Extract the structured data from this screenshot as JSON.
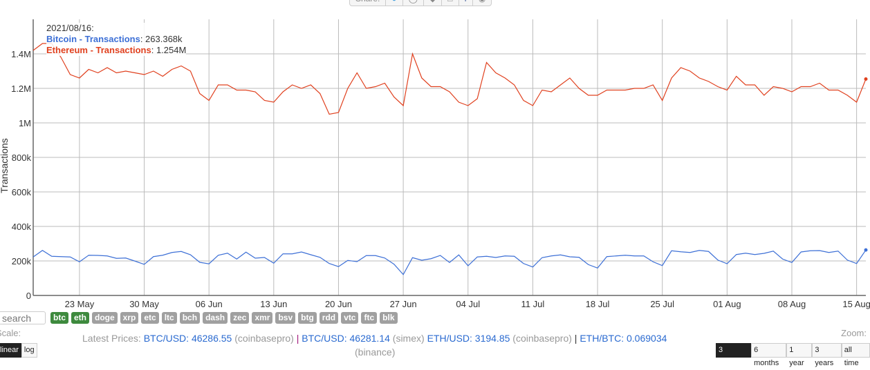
{
  "share": {
    "label": "Share:",
    "icons": [
      "twitter-icon",
      "reddit-icon",
      "vk-icon",
      "like-icon",
      "facebook-icon",
      "pinterest-icon"
    ]
  },
  "tooltip": {
    "date": "2021/08/16:",
    "btc_label": "Bitcoin - Transactions",
    "btc_value": ": 263.368k",
    "eth_label": "Ethereum - Transactions",
    "eth_value": ": 1.254M"
  },
  "chart_data": {
    "type": "line",
    "ylabel": "Transactions",
    "ylim": [
      0,
      1600000
    ],
    "yticks": [
      {
        "v": 0,
        "label": "0"
      },
      {
        "v": 200000,
        "label": "200k"
      },
      {
        "v": 400000,
        "label": "400k"
      },
      {
        "v": 600000,
        "label": "600k"
      },
      {
        "v": 800000,
        "label": "800k"
      },
      {
        "v": 1000000,
        "label": "1M"
      },
      {
        "v": 1200000,
        "label": "1.2M"
      },
      {
        "v": 1400000,
        "label": "1.4M"
      }
    ],
    "xrange": [
      "2021-05-18",
      "2021-08-16"
    ],
    "xticks": [
      {
        "d": "2021-05-23",
        "label": "23 May"
      },
      {
        "d": "2021-05-30",
        "label": "30 May"
      },
      {
        "d": "2021-06-06",
        "label": "06 Jun"
      },
      {
        "d": "2021-06-13",
        "label": "13 Jun"
      },
      {
        "d": "2021-06-20",
        "label": "20 Jun"
      },
      {
        "d": "2021-06-27",
        "label": "27 Jun"
      },
      {
        "d": "2021-07-04",
        "label": "04 Jul"
      },
      {
        "d": "2021-07-11",
        "label": "11 Jul"
      },
      {
        "d": "2021-07-18",
        "label": "18 Jul"
      },
      {
        "d": "2021-07-25",
        "label": "25 Jul"
      },
      {
        "d": "2021-08-01",
        "label": "01 Aug"
      },
      {
        "d": "2021-08-08",
        "label": "08 Aug"
      },
      {
        "d": "2021-08-15",
        "label": "15 Aug"
      }
    ],
    "grid": true,
    "series": [
      {
        "name": "Bitcoin - Transactions",
        "color": "#3c6fd6",
        "values": [
          223000,
          261000,
          227000,
          225000,
          223000,
          195000,
          233000,
          232000,
          229000,
          215000,
          217000,
          199000,
          180000,
          225000,
          233000,
          249000,
          255000,
          236000,
          192000,
          183000,
          233000,
          245000,
          211000,
          251000,
          216000,
          220000,
          187000,
          241000,
          241000,
          252000,
          236000,
          221000,
          185000,
          167000,
          203000,
          196000,
          231000,
          231000,
          217000,
          181000,
          121000,
          219000,
          204000,
          213000,
          232000,
          191000,
          235000,
          172000,
          223000,
          227000,
          220000,
          229000,
          227000,
          185000,
          165000,
          219000,
          229000,
          235000,
          224000,
          221000,
          179000,
          159000,
          225000,
          229000,
          233000,
          229000,
          229000,
          195000,
          173000,
          259000,
          253000,
          249000,
          261000,
          255000,
          205000,
          184000,
          237000,
          245000,
          237000,
          244000,
          257000,
          211000,
          191000,
          252000,
          259000,
          260000,
          249000,
          257000,
          205000,
          185000,
          263368
        ]
      },
      {
        "name": "Ethereum - Transactions",
        "color": "#e0401e",
        "values": [
          1420000,
          1460000,
          1460000,
          1380000,
          1280000,
          1260000,
          1310000,
          1290000,
          1320000,
          1290000,
          1300000,
          1290000,
          1280000,
          1300000,
          1270000,
          1310000,
          1330000,
          1300000,
          1170000,
          1130000,
          1220000,
          1220000,
          1190000,
          1190000,
          1180000,
          1130000,
          1120000,
          1180000,
          1220000,
          1200000,
          1220000,
          1170000,
          1050000,
          1060000,
          1200000,
          1290000,
          1200000,
          1210000,
          1230000,
          1150000,
          1100000,
          1400000,
          1260000,
          1210000,
          1210000,
          1180000,
          1120000,
          1100000,
          1140000,
          1350000,
          1290000,
          1260000,
          1220000,
          1130000,
          1100000,
          1190000,
          1180000,
          1220000,
          1260000,
          1200000,
          1160000,
          1160000,
          1190000,
          1190000,
          1190000,
          1200000,
          1200000,
          1220000,
          1130000,
          1260000,
          1320000,
          1300000,
          1260000,
          1240000,
          1210000,
          1190000,
          1270000,
          1220000,
          1220000,
          1160000,
          1210000,
          1200000,
          1180000,
          1210000,
          1210000,
          1230000,
          1190000,
          1190000,
          1160000,
          1120000,
          1254000
        ]
      }
    ]
  },
  "search": {
    "placeholder": "search"
  },
  "coins": [
    {
      "label": "btc",
      "active": true
    },
    {
      "label": "eth",
      "active": true
    },
    {
      "label": "doge",
      "active": false
    },
    {
      "label": "xrp",
      "active": false
    },
    {
      "label": "etc",
      "active": false
    },
    {
      "label": "ltc",
      "active": false
    },
    {
      "label": "bch",
      "active": false
    },
    {
      "label": "dash",
      "active": false
    },
    {
      "label": "zec",
      "active": false
    },
    {
      "label": "xmr",
      "active": false
    },
    {
      "label": "bsv",
      "active": false
    },
    {
      "label": "btg",
      "active": false
    },
    {
      "label": "rdd",
      "active": false
    },
    {
      "label": "vtc",
      "active": false
    },
    {
      "label": "ftc",
      "active": false
    },
    {
      "label": "blk",
      "active": false
    }
  ],
  "scale": {
    "label": "Scale:",
    "options": [
      "linear",
      "log"
    ],
    "active": "linear"
  },
  "prices": {
    "label": "Latest Prices:",
    "p1": "BTC/USD: 46286.55",
    "s1": "(coinbasepro)",
    "p2": "BTC/USD: 46281.14",
    "s2": "(simex)",
    "p3": "ETH/USD: 3194.85",
    "s3": "(coinbasepro)",
    "p4": "ETH/BTC: 0.069034",
    "s4": "(binance)",
    "sep": "|"
  },
  "zoom": {
    "label": "Zoom:",
    "options": [
      "3 months",
      "6 months",
      "1 year",
      "3 years",
      "all time"
    ],
    "active": "3 months"
  }
}
